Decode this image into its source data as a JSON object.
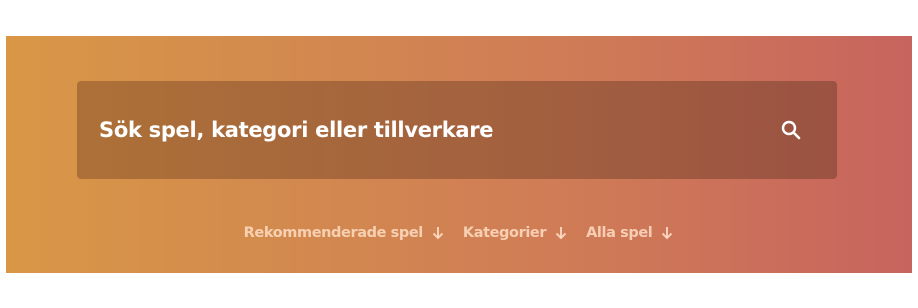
{
  "search": {
    "placeholder": "Sök spel, kategori eller tillverkare"
  },
  "quick_links": [
    {
      "label": "Rekommenderade spel",
      "icon": "arrow-down-icon"
    },
    {
      "label": "Kategorier",
      "icon": "arrow-down-icon"
    },
    {
      "label": "Alla spel",
      "icon": "arrow-down-icon"
    }
  ],
  "colors": {
    "gradient_start": "#d99746",
    "gradient_end": "#c7645e",
    "search_text": "#ffffff"
  }
}
